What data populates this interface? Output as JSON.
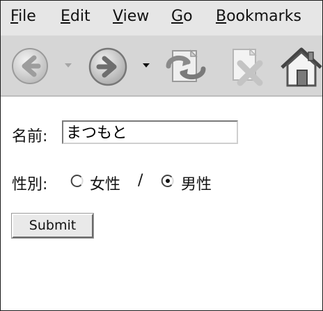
{
  "menubar": {
    "items": [
      {
        "accel": "F",
        "rest": "ile"
      },
      {
        "accel": "E",
        "rest": "dit"
      },
      {
        "accel": "V",
        "rest": "iew"
      },
      {
        "accel": "G",
        "rest": "o"
      },
      {
        "accel": "B",
        "rest": "ookmarks"
      }
    ]
  },
  "toolbar": {
    "icons": [
      "back-icon",
      "dropdown-arrow-icon",
      "forward-icon",
      "dropdown-arrow-icon",
      "reload-icon",
      "stop-icon",
      "home-icon"
    ]
  },
  "form": {
    "name_label": "名前:",
    "name_value": "まつもと",
    "gender_label": "性別:",
    "option_female": "女性",
    "separator": "/",
    "option_male": "男性",
    "selected": "male",
    "submit_label": "Submit"
  }
}
